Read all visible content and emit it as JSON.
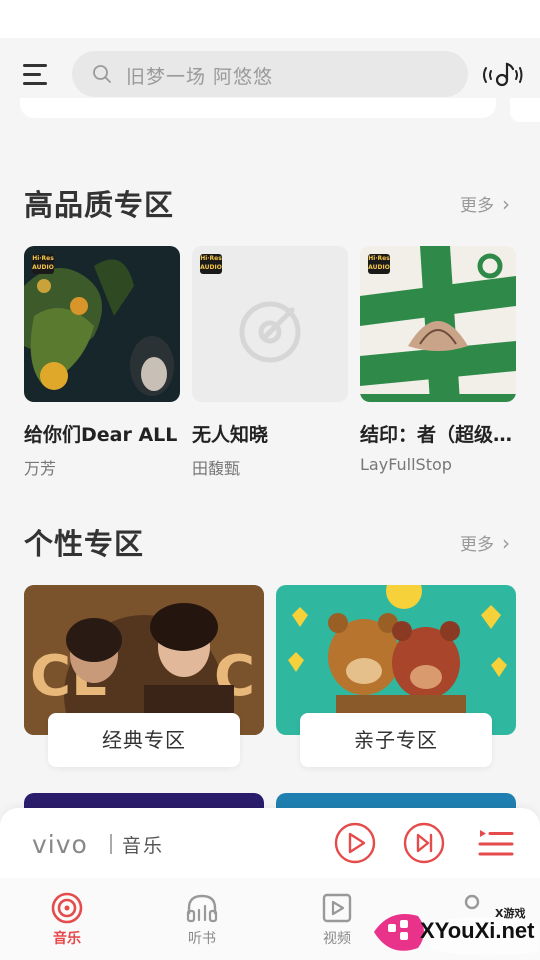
{
  "search": {
    "placeholder": "旧梦一场 阿悠悠"
  },
  "sections": {
    "hq": {
      "title": "高品质专区",
      "more": "更多"
    },
    "personal": {
      "title": "个性专区",
      "more": "更多"
    }
  },
  "albums": [
    {
      "title": "给你们Dear ALL",
      "artist": "万芳",
      "badge": "Hi-Res AUDIO"
    },
    {
      "title": "无人知晓",
      "artist": "田馥甄",
      "badge": "Hi-Res AUDIO"
    },
    {
      "title": "结印：者（超级…",
      "artist": "LayFullStop",
      "badge": "Hi-Res AUDIO"
    }
  ],
  "zones": [
    {
      "label": "经典专区"
    },
    {
      "label": "亲子专区"
    }
  ],
  "player": {
    "brand": "vivo",
    "brand_music": "音乐"
  },
  "tabs": [
    {
      "label": "音乐",
      "active": true
    },
    {
      "label": "听书",
      "active": false
    },
    {
      "label": "视频",
      "active": false
    }
  ],
  "watermark": {
    "top": "X游戏",
    "site": "XYouXi.net"
  },
  "colors": {
    "accent": "#e54b4b",
    "background": "#f5f5f5",
    "hires_gold": "#f5c64a"
  }
}
